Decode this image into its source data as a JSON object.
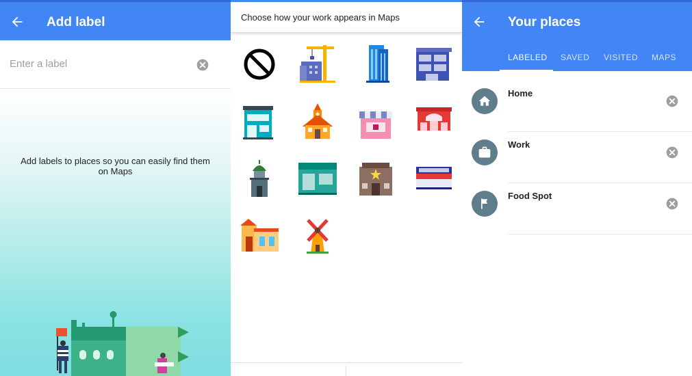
{
  "left_panel": {
    "title": "Add label",
    "label_placeholder": "Enter a label",
    "help_text": "Add labels to places so you can easily find them on Maps"
  },
  "middle_panel": {
    "heading": "Choose how your work appears in Maps",
    "icons": [
      "no-symbol-icon",
      "construction-crane-icon",
      "office-tower-icon",
      "modern-building-icon",
      "storefront-icon",
      "schoolhouse-icon",
      "pink-shop-icon",
      "red-shop-icon",
      "domed-tower-icon",
      "teal-store-icon",
      "saloon-icon",
      "diner-icon",
      "villa-icon",
      "windmill-icon"
    ]
  },
  "right_panel": {
    "title": "Your places",
    "tabs": [
      {
        "label": "LABELED",
        "active": true
      },
      {
        "label": "SAVED",
        "active": false
      },
      {
        "label": "VISITED",
        "active": false
      },
      {
        "label": "MAPS",
        "active": false
      }
    ],
    "places": [
      {
        "name": "Home",
        "icon": "home-icon"
      },
      {
        "name": "Work",
        "icon": "briefcase-icon"
      },
      {
        "name": "Food Spot",
        "icon": "flag-icon"
      }
    ]
  },
  "colors": {
    "app_bar": "#4285f4",
    "avatar": "#607d8b",
    "clear": "#9e9e9e"
  }
}
